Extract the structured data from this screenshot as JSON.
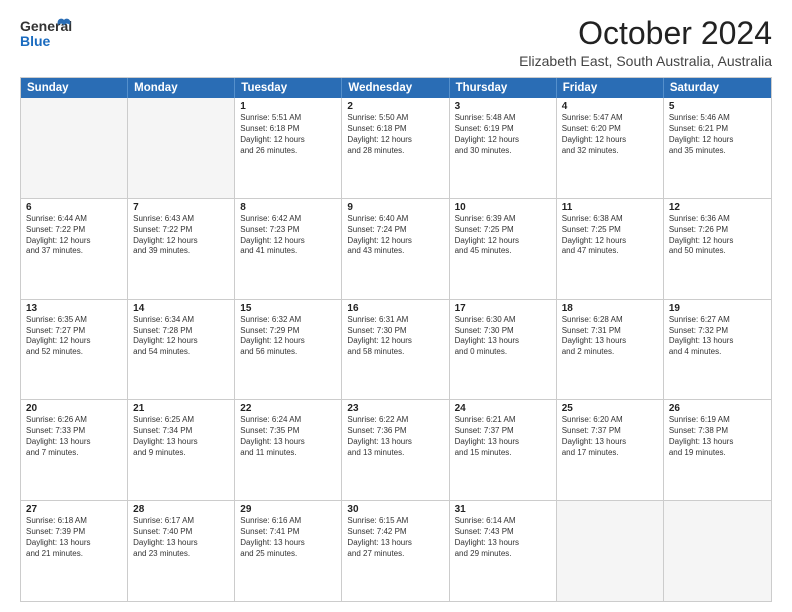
{
  "logo": {
    "line1": "General",
    "line2": "Blue"
  },
  "title": "October 2024",
  "location": "Elizabeth East, South Australia, Australia",
  "days": [
    "Sunday",
    "Monday",
    "Tuesday",
    "Wednesday",
    "Thursday",
    "Friday",
    "Saturday"
  ],
  "weeks": [
    [
      {
        "day": "",
        "lines": []
      },
      {
        "day": "",
        "lines": []
      },
      {
        "day": "1",
        "lines": [
          "Sunrise: 5:51 AM",
          "Sunset: 6:18 PM",
          "Daylight: 12 hours",
          "and 26 minutes."
        ]
      },
      {
        "day": "2",
        "lines": [
          "Sunrise: 5:50 AM",
          "Sunset: 6:18 PM",
          "Daylight: 12 hours",
          "and 28 minutes."
        ]
      },
      {
        "day": "3",
        "lines": [
          "Sunrise: 5:48 AM",
          "Sunset: 6:19 PM",
          "Daylight: 12 hours",
          "and 30 minutes."
        ]
      },
      {
        "day": "4",
        "lines": [
          "Sunrise: 5:47 AM",
          "Sunset: 6:20 PM",
          "Daylight: 12 hours",
          "and 32 minutes."
        ]
      },
      {
        "day": "5",
        "lines": [
          "Sunrise: 5:46 AM",
          "Sunset: 6:21 PM",
          "Daylight: 12 hours",
          "and 35 minutes."
        ]
      }
    ],
    [
      {
        "day": "6",
        "lines": [
          "Sunrise: 6:44 AM",
          "Sunset: 7:22 PM",
          "Daylight: 12 hours",
          "and 37 minutes."
        ]
      },
      {
        "day": "7",
        "lines": [
          "Sunrise: 6:43 AM",
          "Sunset: 7:22 PM",
          "Daylight: 12 hours",
          "and 39 minutes."
        ]
      },
      {
        "day": "8",
        "lines": [
          "Sunrise: 6:42 AM",
          "Sunset: 7:23 PM",
          "Daylight: 12 hours",
          "and 41 minutes."
        ]
      },
      {
        "day": "9",
        "lines": [
          "Sunrise: 6:40 AM",
          "Sunset: 7:24 PM",
          "Daylight: 12 hours",
          "and 43 minutes."
        ]
      },
      {
        "day": "10",
        "lines": [
          "Sunrise: 6:39 AM",
          "Sunset: 7:25 PM",
          "Daylight: 12 hours",
          "and 45 minutes."
        ]
      },
      {
        "day": "11",
        "lines": [
          "Sunrise: 6:38 AM",
          "Sunset: 7:25 PM",
          "Daylight: 12 hours",
          "and 47 minutes."
        ]
      },
      {
        "day": "12",
        "lines": [
          "Sunrise: 6:36 AM",
          "Sunset: 7:26 PM",
          "Daylight: 12 hours",
          "and 50 minutes."
        ]
      }
    ],
    [
      {
        "day": "13",
        "lines": [
          "Sunrise: 6:35 AM",
          "Sunset: 7:27 PM",
          "Daylight: 12 hours",
          "and 52 minutes."
        ]
      },
      {
        "day": "14",
        "lines": [
          "Sunrise: 6:34 AM",
          "Sunset: 7:28 PM",
          "Daylight: 12 hours",
          "and 54 minutes."
        ]
      },
      {
        "day": "15",
        "lines": [
          "Sunrise: 6:32 AM",
          "Sunset: 7:29 PM",
          "Daylight: 12 hours",
          "and 56 minutes."
        ]
      },
      {
        "day": "16",
        "lines": [
          "Sunrise: 6:31 AM",
          "Sunset: 7:30 PM",
          "Daylight: 12 hours",
          "and 58 minutes."
        ]
      },
      {
        "day": "17",
        "lines": [
          "Sunrise: 6:30 AM",
          "Sunset: 7:30 PM",
          "Daylight: 13 hours",
          "and 0 minutes."
        ]
      },
      {
        "day": "18",
        "lines": [
          "Sunrise: 6:28 AM",
          "Sunset: 7:31 PM",
          "Daylight: 13 hours",
          "and 2 minutes."
        ]
      },
      {
        "day": "19",
        "lines": [
          "Sunrise: 6:27 AM",
          "Sunset: 7:32 PM",
          "Daylight: 13 hours",
          "and 4 minutes."
        ]
      }
    ],
    [
      {
        "day": "20",
        "lines": [
          "Sunrise: 6:26 AM",
          "Sunset: 7:33 PM",
          "Daylight: 13 hours",
          "and 7 minutes."
        ]
      },
      {
        "day": "21",
        "lines": [
          "Sunrise: 6:25 AM",
          "Sunset: 7:34 PM",
          "Daylight: 13 hours",
          "and 9 minutes."
        ]
      },
      {
        "day": "22",
        "lines": [
          "Sunrise: 6:24 AM",
          "Sunset: 7:35 PM",
          "Daylight: 13 hours",
          "and 11 minutes."
        ]
      },
      {
        "day": "23",
        "lines": [
          "Sunrise: 6:22 AM",
          "Sunset: 7:36 PM",
          "Daylight: 13 hours",
          "and 13 minutes."
        ]
      },
      {
        "day": "24",
        "lines": [
          "Sunrise: 6:21 AM",
          "Sunset: 7:37 PM",
          "Daylight: 13 hours",
          "and 15 minutes."
        ]
      },
      {
        "day": "25",
        "lines": [
          "Sunrise: 6:20 AM",
          "Sunset: 7:37 PM",
          "Daylight: 13 hours",
          "and 17 minutes."
        ]
      },
      {
        "day": "26",
        "lines": [
          "Sunrise: 6:19 AM",
          "Sunset: 7:38 PM",
          "Daylight: 13 hours",
          "and 19 minutes."
        ]
      }
    ],
    [
      {
        "day": "27",
        "lines": [
          "Sunrise: 6:18 AM",
          "Sunset: 7:39 PM",
          "Daylight: 13 hours",
          "and 21 minutes."
        ]
      },
      {
        "day": "28",
        "lines": [
          "Sunrise: 6:17 AM",
          "Sunset: 7:40 PM",
          "Daylight: 13 hours",
          "and 23 minutes."
        ]
      },
      {
        "day": "29",
        "lines": [
          "Sunrise: 6:16 AM",
          "Sunset: 7:41 PM",
          "Daylight: 13 hours",
          "and 25 minutes."
        ]
      },
      {
        "day": "30",
        "lines": [
          "Sunrise: 6:15 AM",
          "Sunset: 7:42 PM",
          "Daylight: 13 hours",
          "and 27 minutes."
        ]
      },
      {
        "day": "31",
        "lines": [
          "Sunrise: 6:14 AM",
          "Sunset: 7:43 PM",
          "Daylight: 13 hours",
          "and 29 minutes."
        ]
      },
      {
        "day": "",
        "lines": []
      },
      {
        "day": "",
        "lines": []
      }
    ]
  ]
}
